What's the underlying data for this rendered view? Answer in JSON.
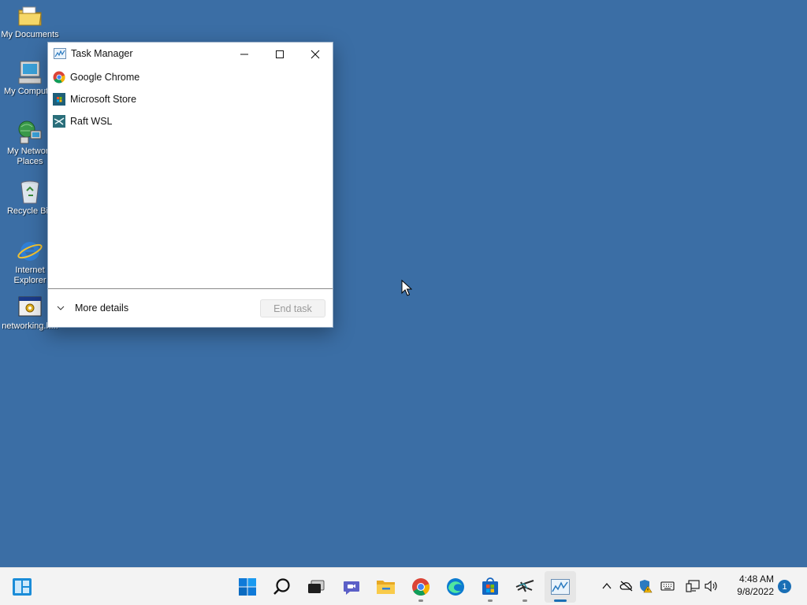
{
  "desktop": {
    "icons": [
      {
        "label": "My Documents",
        "icon": "folder-icon"
      },
      {
        "label": "My Computer",
        "icon": "computer-icon"
      },
      {
        "label": "My Network Places",
        "icon": "network-icon"
      },
      {
        "label": "Recycle Bin",
        "icon": "recycle-bin-icon"
      },
      {
        "label": "Internet Explorer",
        "icon": "internet-explorer-icon"
      },
      {
        "label": "networking.h...",
        "icon": "setup-program-icon"
      }
    ],
    "background_color": "#3b6ea5"
  },
  "task_manager": {
    "title": "Task Manager",
    "apps": [
      {
        "name": "Google Chrome",
        "icon": "chrome-icon"
      },
      {
        "name": "Microsoft Store",
        "icon": "store-icon"
      },
      {
        "name": "Raft WSL",
        "icon": "raft-wsl-icon"
      }
    ],
    "more_details_label": "More details",
    "end_task_label": "End task",
    "end_task_enabled": false
  },
  "taskbar": {
    "pinned": [
      {
        "name": "start",
        "icon": "windows-start-icon",
        "running": false
      },
      {
        "name": "search",
        "icon": "search-icon",
        "running": false
      },
      {
        "name": "task-view",
        "icon": "task-view-icon",
        "running": false
      },
      {
        "name": "chat",
        "icon": "teams-chat-icon",
        "running": false
      },
      {
        "name": "file-explorer",
        "icon": "folder-icon",
        "running": false
      },
      {
        "name": "chrome",
        "icon": "chrome-icon",
        "running": true
      },
      {
        "name": "edge",
        "icon": "edge-icon",
        "running": false
      },
      {
        "name": "store",
        "icon": "store-icon",
        "running": true
      },
      {
        "name": "raft-wsl",
        "icon": "raft-wsl-icon",
        "running": true
      },
      {
        "name": "task-manager",
        "icon": "task-manager-icon",
        "running": true,
        "active": true
      }
    ],
    "tray": [
      "chevron-up-icon",
      "onedrive-offline-icon",
      "security-warning-icon",
      "keyboard-icon",
      "network-icon",
      "volume-icon"
    ],
    "time": "4:48 AM",
    "date": "9/8/2022",
    "notification_count": "1",
    "accent_color": "#1a6fb5"
  }
}
